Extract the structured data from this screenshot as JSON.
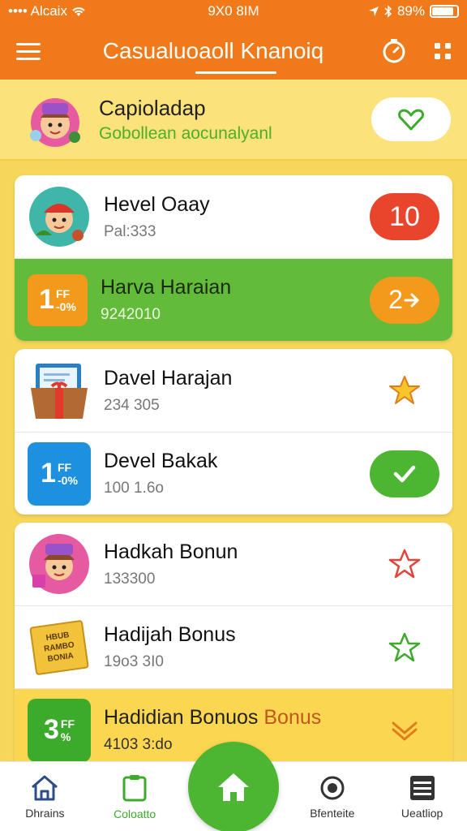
{
  "status": {
    "carrier": "•••• Alcaix",
    "time": "9X0 8IM",
    "battery": "89%"
  },
  "appbar": {
    "title": "Casualuoaoll Knanoiq"
  },
  "banner": {
    "title": "Capioladap",
    "subtitle": "Gobollean aocunalyanl"
  },
  "cards": [
    {
      "rows": [
        {
          "name": "Hevel Oaay",
          "sub": "Pal:333",
          "badge": "10"
        },
        {
          "name": "Harva Haraian",
          "sub": "9242010",
          "left_badge": {
            "big": "1",
            "small1": "FF",
            "small2": "-0%"
          },
          "action": "2"
        }
      ]
    },
    {
      "rows": [
        {
          "name": "Davel Harajan",
          "sub": "234 305"
        },
        {
          "name": "Devel Bakak",
          "sub": "100 1.6o",
          "left_badge": {
            "big": "1",
            "small1": "FF",
            "small2": "-0%"
          }
        }
      ]
    },
    {
      "rows": [
        {
          "name": "Hadkah Bonun",
          "sub": "133300"
        },
        {
          "name": "Hadijah Bonus",
          "sub": "19o3 3I0",
          "tag": [
            "HBUB",
            "RAMBO",
            "BONIA"
          ]
        },
        {
          "name": "Hadidian Bonuos",
          "name_hl": "Bonus",
          "sub": "4103 3:do",
          "left_badge": {
            "big": "3",
            "small1": "FF",
            "small2": "%"
          }
        }
      ]
    }
  ],
  "bottom_nav": [
    {
      "label": "Dhrains"
    },
    {
      "label": "Coloatto"
    },
    {
      "label": "Bfenteite"
    },
    {
      "label": "Ueatliop"
    }
  ],
  "colors": {
    "primary": "#f07a1a",
    "accent_green": "#4cb532",
    "banner_bg": "#fbe27a",
    "page_bg": "#f7d75a"
  }
}
